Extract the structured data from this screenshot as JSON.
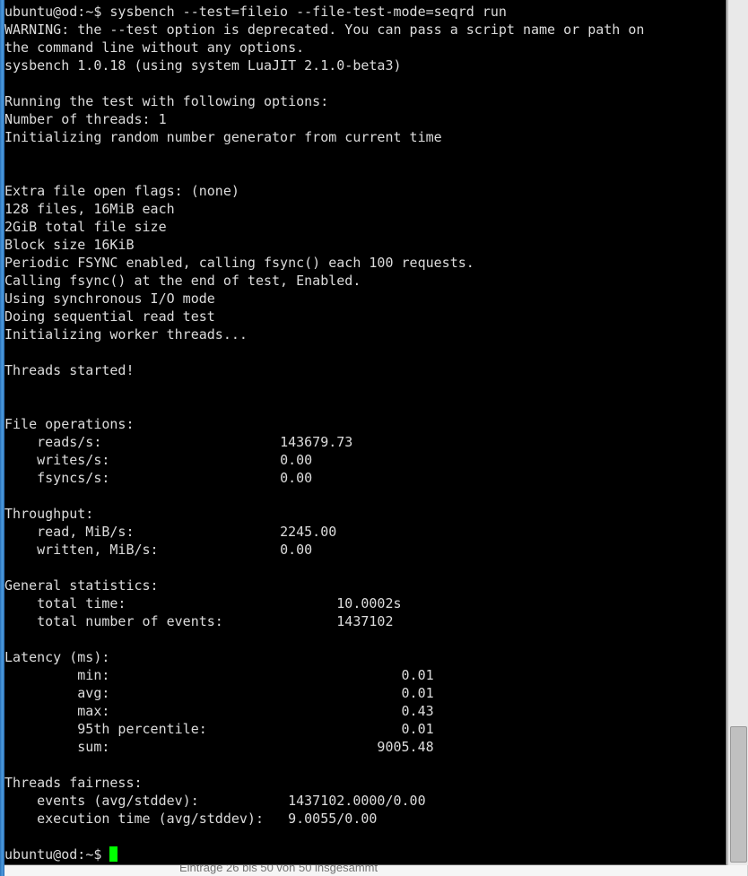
{
  "prompt": {
    "user_host": "ubuntu@od",
    "path": "~",
    "symbol": "$",
    "command": "sysbench --test=fileio --file-test-mode=seqrd run"
  },
  "output": {
    "warning_l1": "WARNING: the --test option is deprecated. You can pass a script name or path on",
    "warning_l2": "the command line without any options.",
    "version": "sysbench 1.0.18 (using system LuaJIT 2.1.0-beta3)",
    "run_opts": "Running the test with following options:",
    "threads": "Number of threads: 1",
    "rng": "Initializing random number generator from current time",
    "flags": "Extra file open flags: (none)",
    "files": "128 files, 16MiB each",
    "total_size": "2GiB total file size",
    "block_size": "Block size 16KiB",
    "fsync_periodic": "Periodic FSYNC enabled, calling fsync() each 100 requests.",
    "fsync_end": "Calling fsync() at the end of test, Enabled.",
    "io_mode": "Using synchronous I/O mode",
    "test_type": "Doing sequential read test",
    "workers": "Initializing worker threads...",
    "started": "Threads started!",
    "fileops_hdr": "File operations:",
    "reads_label": "    reads/s:",
    "reads_val": "143679.73",
    "writes_label": "    writes/s:",
    "writes_val": "0.00",
    "fsyncs_label": "    fsyncs/s:",
    "fsyncs_val": "0.00",
    "throughput_hdr": "Throughput:",
    "read_mibs_label": "    read, MiB/s:",
    "read_mibs_val": "2245.00",
    "written_mibs_label": "    written, MiB/s:",
    "written_mibs_val": "0.00",
    "stats_hdr": "General statistics:",
    "total_time_label": "    total time:",
    "total_time_val": "10.0002s",
    "total_events_label": "    total number of events:",
    "total_events_val": "1437102",
    "latency_hdr": "Latency (ms):",
    "lat_min_label": "         min:",
    "lat_min_val": "0.01",
    "lat_avg_label": "         avg:",
    "lat_avg_val": "0.01",
    "lat_max_label": "         max:",
    "lat_max_val": "0.43",
    "lat_95_label": "         95th percentile:",
    "lat_95_val": "0.01",
    "lat_sum_label": "         sum:",
    "lat_sum_val": "9005.48",
    "fairness_hdr": "Threads fairness:",
    "events_label": "    events (avg/stddev):",
    "events_val": "1437102.0000/0.00",
    "exec_time_label": "    execution time (avg/stddev):",
    "exec_time_val": "9.0055/0.00"
  },
  "prompt2": {
    "user_host": "ubuntu@od",
    "path": "~",
    "symbol": "$"
  },
  "bottom_text": "Einträge 26 bis 50 von 50 insgesammt"
}
